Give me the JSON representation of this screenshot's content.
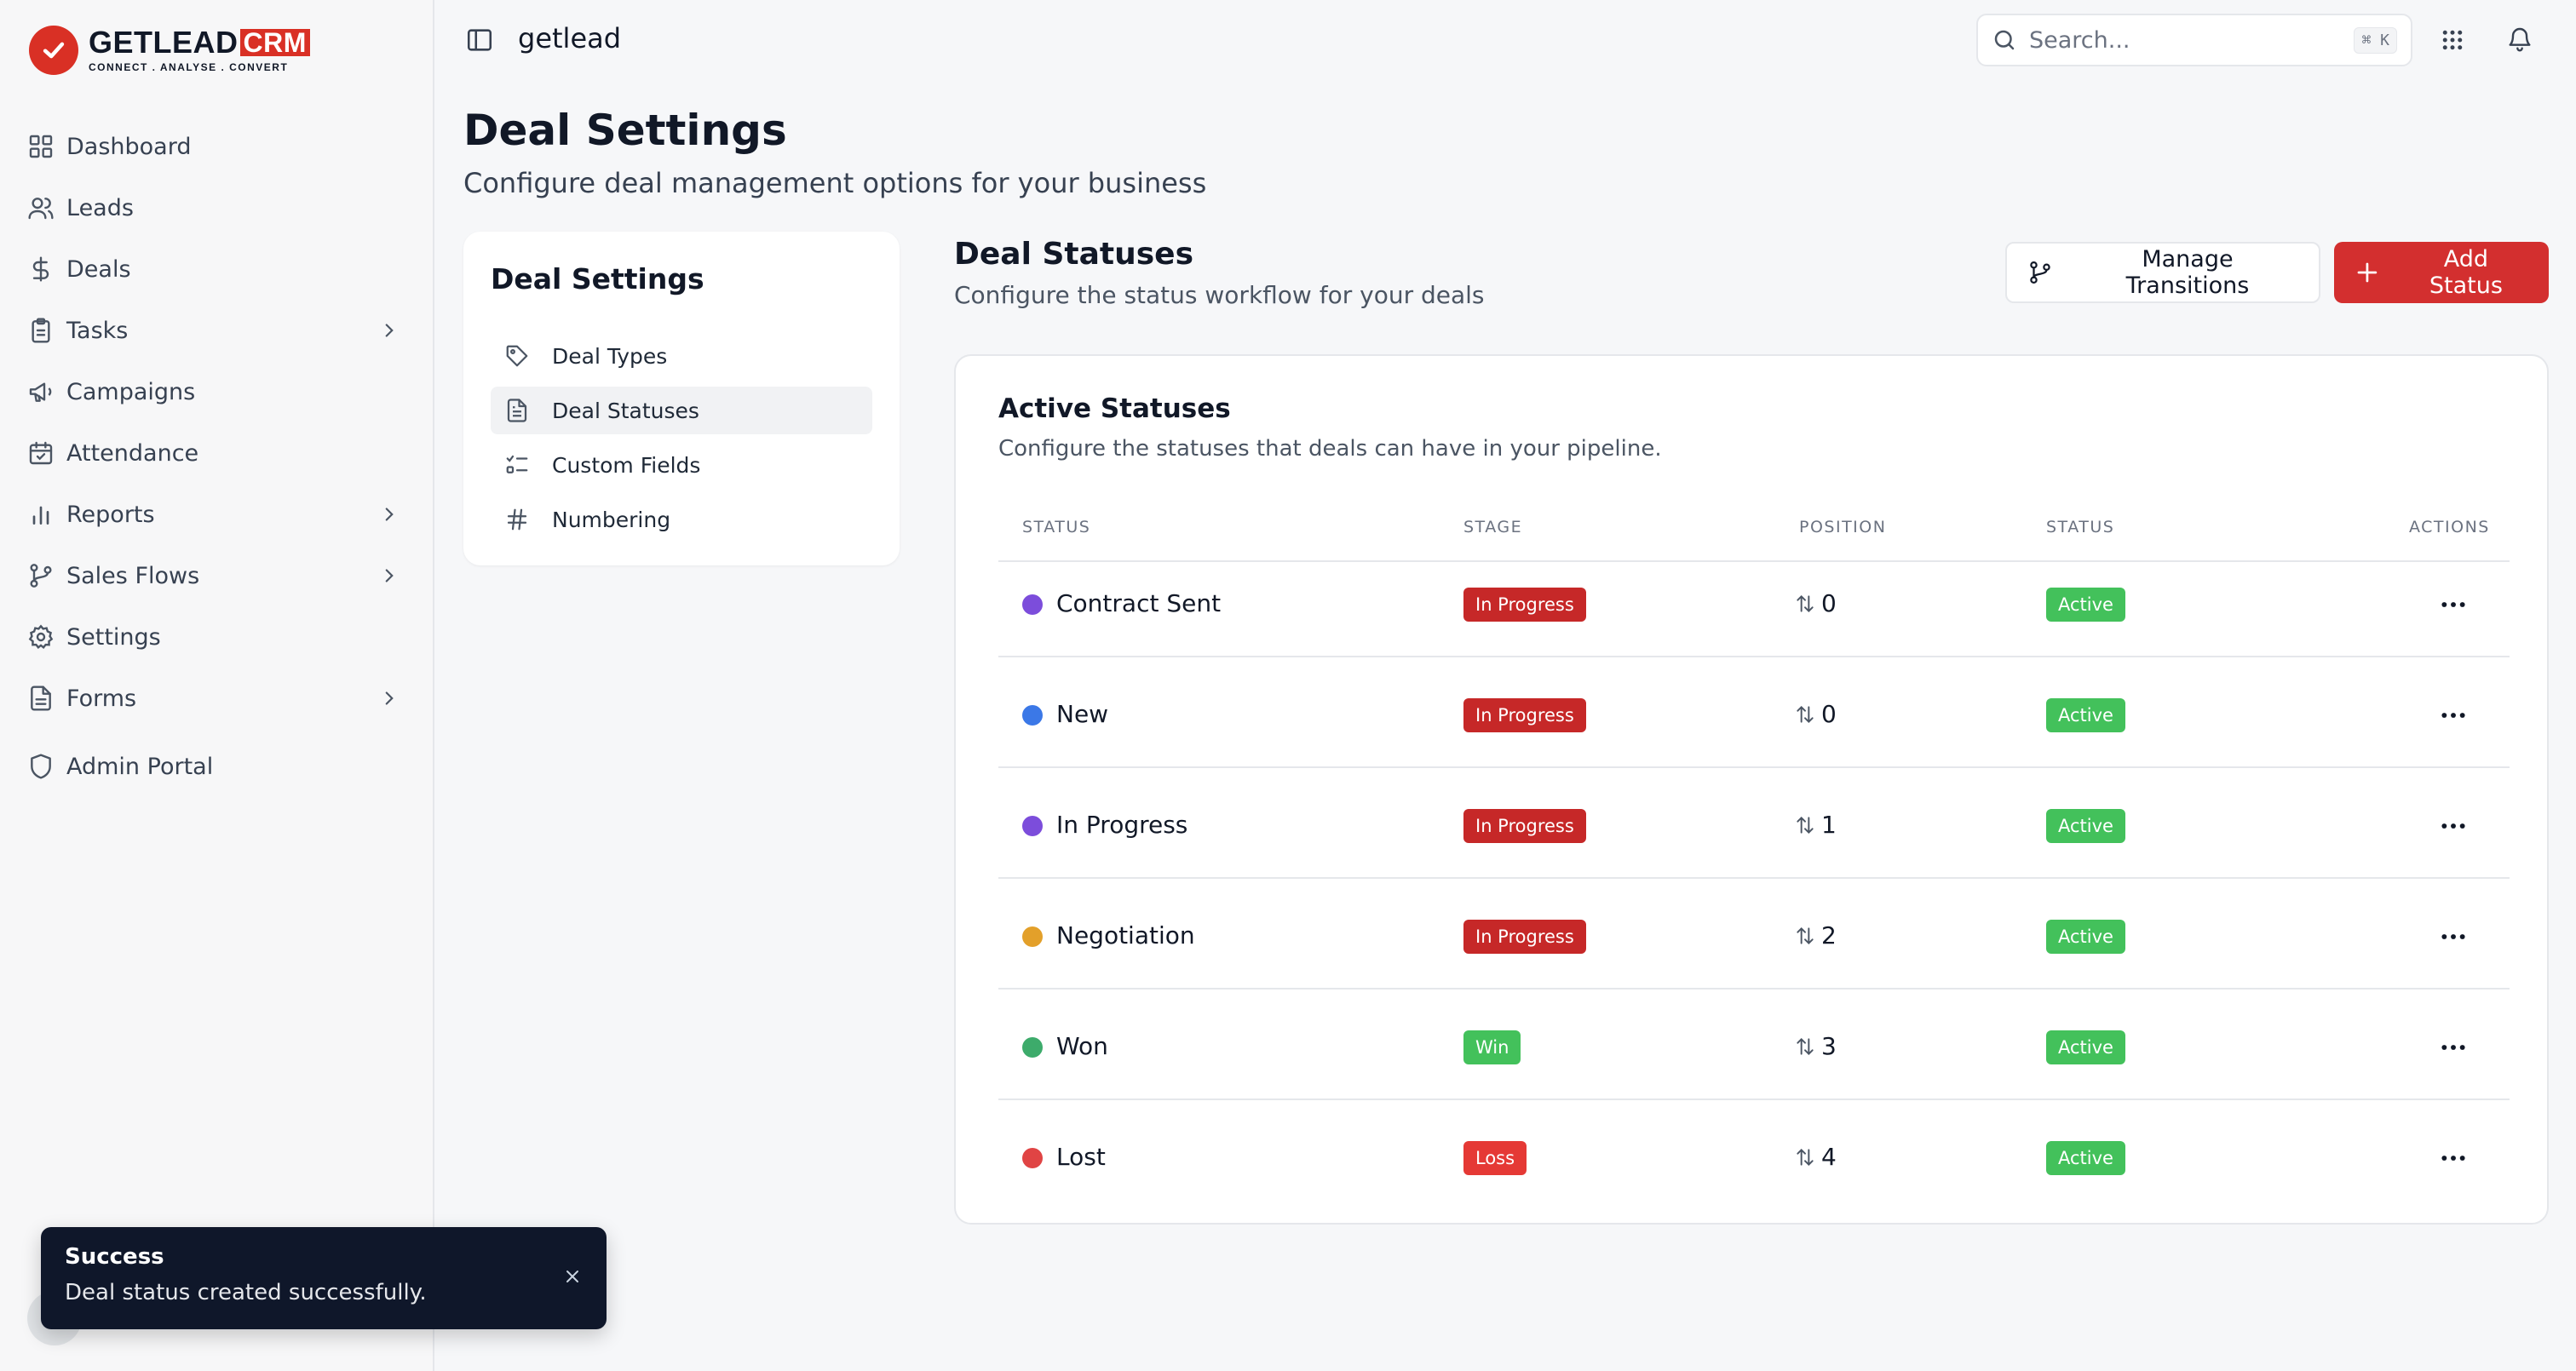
{
  "app": {
    "logo_word": "GETLEAD",
    "logo_crm": "CRM",
    "logo_tagline": "CONNECT  .  ANALYSE  .  CONVERT",
    "brand_color": "#d32f2f",
    "org_name": "getlead"
  },
  "sidebar": {
    "items": [
      {
        "label": "Dashboard",
        "icon": "grid-icon",
        "has_submenu": false
      },
      {
        "label": "Leads",
        "icon": "users-icon",
        "has_submenu": false
      },
      {
        "label": "Deals",
        "icon": "dollar-icon",
        "has_submenu": false
      },
      {
        "label": "Tasks",
        "icon": "clipboard-icon",
        "has_submenu": true
      },
      {
        "label": "Campaigns",
        "icon": "megaphone-icon",
        "has_submenu": false
      },
      {
        "label": "Attendance",
        "icon": "calendar-check-icon",
        "has_submenu": false
      },
      {
        "label": "Reports",
        "icon": "bar-chart-icon",
        "has_submenu": true
      },
      {
        "label": "Sales Flows",
        "icon": "git-branch-icon",
        "has_submenu": true
      },
      {
        "label": "Settings",
        "icon": "gear-icon",
        "has_submenu": false
      },
      {
        "label": "Forms",
        "icon": "file-text-icon",
        "has_submenu": true
      }
    ],
    "admin": {
      "label": "Admin Portal",
      "icon": "shield-icon"
    }
  },
  "search": {
    "placeholder": "Search...",
    "shortcut": "⌘ K"
  },
  "page": {
    "title": "Deal Settings",
    "subtitle": "Configure deal management options for your business"
  },
  "settings_menu": {
    "title": "Deal Settings",
    "items": [
      {
        "label": "Deal Types",
        "icon": "tag-icon",
        "active": false
      },
      {
        "label": "Deal Statuses",
        "icon": "document-icon",
        "active": true
      },
      {
        "label": "Custom Fields",
        "icon": "list-checks-icon",
        "active": false
      },
      {
        "label": "Numbering",
        "icon": "hash-icon",
        "active": false
      }
    ]
  },
  "statuses": {
    "title": "Deal Statuses",
    "subtitle": "Configure the status workflow for your deals",
    "manage_button": "Manage Transitions",
    "add_button": "Add Status",
    "card_title": "Active Statuses",
    "card_subtitle": "Configure the statuses that deals can have in your pipeline.",
    "columns": [
      "STATUS",
      "STAGE",
      "POSITION",
      "STATUS",
      "ACTIONS"
    ],
    "rows": [
      {
        "name": "Contract Sent",
        "color": "#7c4ddb",
        "stage": "In Progress",
        "stage_color": "#c62828",
        "position": "0",
        "status": "Active"
      },
      {
        "name": "New",
        "color": "#3b78e7",
        "stage": "In Progress",
        "stage_color": "#c62828",
        "position": "0",
        "status": "Active"
      },
      {
        "name": "In Progress",
        "color": "#7c4ddb",
        "stage": "In Progress",
        "stage_color": "#c62828",
        "position": "1",
        "status": "Active"
      },
      {
        "name": "Negotiation",
        "color": "#e3a02a",
        "stage": "In Progress",
        "stage_color": "#c62828",
        "position": "2",
        "status": "Active"
      },
      {
        "name": "Won",
        "color": "#3dab6b",
        "stage": "Win",
        "stage_color": "#43c15b",
        "position": "3",
        "status": "Active"
      },
      {
        "name": "Lost",
        "color": "#e04444",
        "stage": "Loss",
        "stage_color": "#e53935",
        "position": "4",
        "status": "Active"
      }
    ],
    "active_badge_color": "#43c15b"
  },
  "toast": {
    "title": "Success",
    "message": "Deal status created successfully."
  }
}
